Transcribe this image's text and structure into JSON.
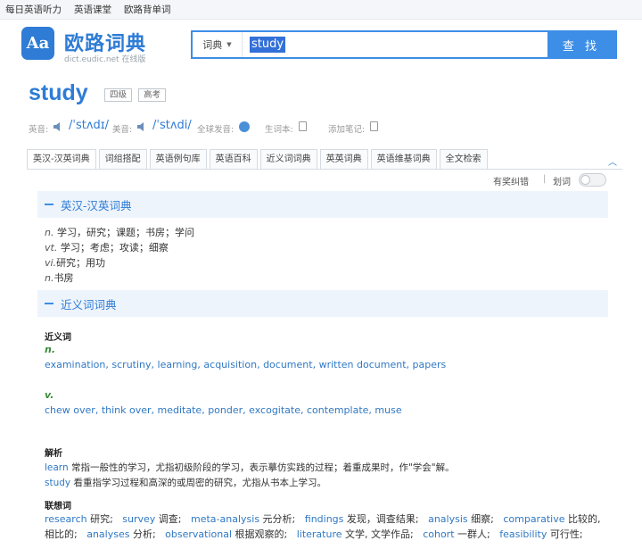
{
  "topbar": {
    "links": [
      "每日英语听力",
      "英语课堂",
      "欧路背单词"
    ]
  },
  "logo": {
    "glyph": "Aa",
    "title": "欧路词典",
    "subtitle": "dict.eudic.net 在线版"
  },
  "search": {
    "mode": "词典",
    "value": "study",
    "button": "查 找"
  },
  "word": {
    "text": "study",
    "tags": [
      "四级",
      "高考"
    ]
  },
  "pron": {
    "uk_label": "英音:",
    "uk_phon": "/ˈstʌdɪ/",
    "us_label": "美音:",
    "us_phon": "/ˈstʌdi/",
    "global_label": "全球发音:",
    "wordbook_label": "生词本:",
    "note_label": "添加笔记:"
  },
  "tabs": [
    "英汉-汉英词典",
    "词组搭配",
    "英语例句库",
    "英语百科",
    "近义词词典",
    "英英词典",
    "英语维基词典",
    "全文检索"
  ],
  "toolbar": {
    "feedback": "有奖纠错",
    "sep": "|",
    "huaci": "划词"
  },
  "sections": {
    "dict": {
      "title": "英汉-汉英词典",
      "defs": [
        {
          "pos": "n.",
          "text": " 学习，研究；课题；书房；学问"
        },
        {
          "pos": "vt.",
          "text": " 学习；考虑；攻读；细察"
        },
        {
          "pos": "vi.",
          "text": "研究；用功"
        },
        {
          "pos": "n.",
          "text": "书房"
        }
      ]
    },
    "syn": {
      "title": "近义词词典",
      "label": "近义词",
      "n_pos": "n.",
      "n_words": [
        "examination",
        "scrutiny",
        "learning",
        "acquisition",
        "document",
        "written document",
        "papers"
      ],
      "v_pos": "v.",
      "v_words": [
        "chew over",
        "think over",
        "meditate",
        "ponder",
        "excogitate",
        "contemplate",
        "muse"
      ],
      "analysis_label": "解析",
      "analysis": [
        {
          "word": "learn",
          "text": " 常指一般性的学习，尤指初级阶段的学习，表示摹仿实践的过程；着重成果时，作\"学会\"解。"
        },
        {
          "word": "study",
          "text": " 看重指学习过程和高深的或周密的研究，尤指从书本上学习。"
        }
      ],
      "assoc_label": "联想词",
      "assoc": [
        {
          "word": "research",
          "text": " 研究;"
        },
        {
          "word": "survey",
          "text": " 调查;"
        },
        {
          "word": "meta-analysis",
          "text": " 元分析;"
        },
        {
          "word": "findings",
          "text": " 发现，调查结果;"
        },
        {
          "word": "analysis",
          "text": " 细察;"
        },
        {
          "word": "comparative",
          "text": " 比较的, 相比的;"
        },
        {
          "word": "analyses",
          "text": " 分析;"
        },
        {
          "word": "observational",
          "text": " 根据观察的;"
        },
        {
          "word": "literature",
          "text": " 文学, 文学作品;"
        },
        {
          "word": "cohort",
          "text": " 一群人;"
        },
        {
          "word": "feasibility",
          "text": " 可行性;"
        }
      ]
    }
  },
  "colors": {
    "accent": "#2e7cd6",
    "link": "#2f78c4",
    "pos_green": "#3a8a3a",
    "section_bg": "#eef4fb"
  }
}
